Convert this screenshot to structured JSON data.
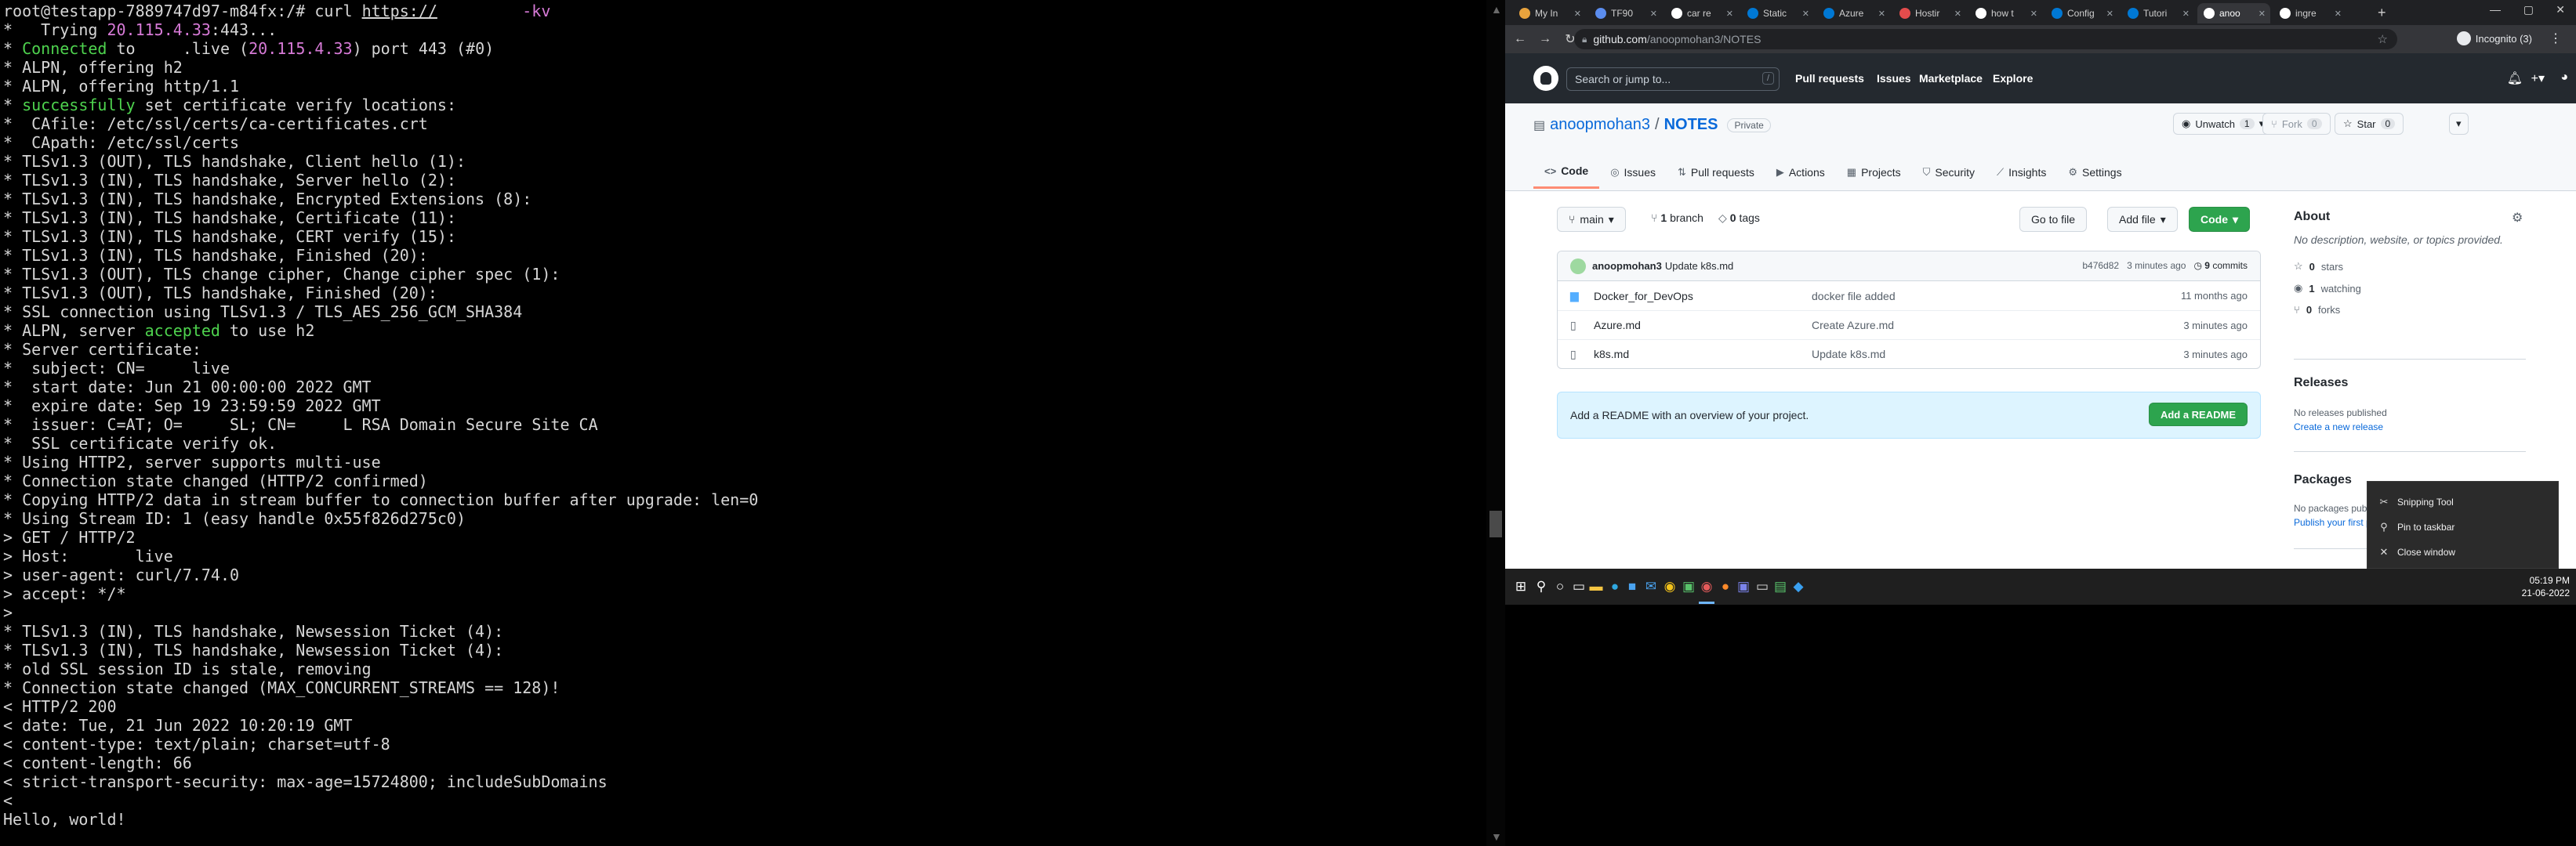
{
  "terminal": {
    "lines": [
      [
        {
          "t": "root@testapp-7889747d97-m84fx:/# curl "
        },
        {
          "t": "https://",
          "c": "u"
        },
        {
          "t": "       ",
          "c": "r"
        },
        {
          "t": "  -kv",
          "c": "p"
        }
      ],
      [
        {
          "t": "*   Trying "
        },
        {
          "t": "20.115.4.33",
          "c": "p"
        },
        {
          "t": ":443..."
        }
      ],
      [
        {
          "t": "* "
        },
        {
          "t": "Connected",
          "c": "g"
        },
        {
          "t": " to "
        },
        {
          "t": "    ",
          "c": "r"
        },
        {
          "t": ".live ("
        },
        {
          "t": "20.115.4.33",
          "c": "p"
        },
        {
          "t": ") port 443 (#0)"
        }
      ],
      [
        {
          "t": "* ALPN, offering h2"
        }
      ],
      [
        {
          "t": "* ALPN, offering http/1.1"
        }
      ],
      [
        {
          "t": "* "
        },
        {
          "t": "successfully",
          "c": "g"
        },
        {
          "t": " set certificate verify locations:"
        }
      ],
      [
        {
          "t": "*  CAfile: /etc/ssl/certs/ca-certificates.crt"
        }
      ],
      [
        {
          "t": "*  CApath: /etc/ssl/certs"
        }
      ],
      [
        {
          "t": "* TLSv1.3 (OUT), TLS handshake, Client hello (1):"
        }
      ],
      [
        {
          "t": "* TLSv1.3 (IN), TLS handshake, Server hello (2):"
        }
      ],
      [
        {
          "t": "* TLSv1.3 (IN), TLS handshake, Encrypted Extensions (8):"
        }
      ],
      [
        {
          "t": "* TLSv1.3 (IN), TLS handshake, Certificate (11):"
        }
      ],
      [
        {
          "t": "* TLSv1.3 (IN), TLS handshake, CERT verify (15):"
        }
      ],
      [
        {
          "t": "* TLSv1.3 (IN), TLS handshake, Finished (20):"
        }
      ],
      [
        {
          "t": "* TLSv1.3 (OUT), TLS change cipher, Change cipher spec (1):"
        }
      ],
      [
        {
          "t": "* TLSv1.3 (OUT), TLS handshake, Finished (20):"
        }
      ],
      [
        {
          "t": "* SSL connection using TLSv1.3 / TLS_AES_256_GCM_SHA384"
        }
      ],
      [
        {
          "t": "* ALPN, server "
        },
        {
          "t": "accepted",
          "c": "g"
        },
        {
          "t": " to use h2"
        }
      ],
      [
        {
          "t": "* Server certificate:"
        }
      ],
      [
        {
          "t": "*  subject: CN="
        },
        {
          "t": "     ",
          "c": "r"
        },
        {
          "t": "live"
        }
      ],
      [
        {
          "t": "*  start date: Jun 21 00:00:00 2022 GMT"
        }
      ],
      [
        {
          "t": "*  expire date: Sep 19 23:59:59 2022 GMT"
        }
      ],
      [
        {
          "t": "*  issuer: C=AT; O="
        },
        {
          "t": "     ",
          "c": "r"
        },
        {
          "t": "SL; CN="
        },
        {
          "t": "     ",
          "c": "r"
        },
        {
          "t": "L RSA Domain Secure Site CA"
        }
      ],
      [
        {
          "t": "*  SSL certificate verify ok."
        }
      ],
      [
        {
          "t": "* Using HTTP2, server supports multi-use"
        }
      ],
      [
        {
          "t": "* Connection state changed (HTTP/2 confirmed)"
        }
      ],
      [
        {
          "t": "* Copying HTTP/2 data in stream buffer to connection buffer after upgrade: len=0"
        }
      ],
      [
        {
          "t": "* Using Stream ID: 1 (easy handle 0x55f826d275c0)"
        }
      ],
      [
        {
          "t": "> GET / HTTP/2"
        }
      ],
      [
        {
          "t": "> Host: "
        },
        {
          "t": "      ",
          "c": "r"
        },
        {
          "t": "live"
        }
      ],
      [
        {
          "t": "> user-agent: curl/7.74.0"
        }
      ],
      [
        {
          "t": "> accept: */*"
        }
      ],
      [
        {
          "t": ">"
        }
      ],
      [
        {
          "t": "* TLSv1.3 (IN), TLS handshake, Newsession Ticket (4):"
        }
      ],
      [
        {
          "t": "* TLSv1.3 (IN), TLS handshake, Newsession Ticket (4):"
        }
      ],
      [
        {
          "t": "* old SSL session ID is stale, removing"
        }
      ],
      [
        {
          "t": "* Connection state changed (MAX_CONCURRENT_STREAMS == 128)!"
        }
      ],
      [
        {
          "t": "< HTTP/2 200"
        }
      ],
      [
        {
          "t": "< date: Tue, 21 Jun 2022 10:20:19 GMT"
        }
      ],
      [
        {
          "t": "< content-type: text/plain; charset=utf-8"
        }
      ],
      [
        {
          "t": "< content-length: 66"
        }
      ],
      [
        {
          "t": "< strict-transport-security: max-age=15724800; includeSubDomains"
        }
      ],
      [
        {
          "t": "<"
        }
      ],
      [
        {
          "t": "Hello, world!"
        }
      ]
    ],
    "scroll_up_icon": "triangle-up-icon",
    "scroll_down_icon": "triangle-down-icon"
  },
  "browser": {
    "tabs": [
      {
        "label": "My In",
        "fav": "#e8a33d"
      },
      {
        "label": "TF90",
        "fav": "#5b8def"
      },
      {
        "label": "car re",
        "fav": "#ffffff"
      },
      {
        "label": "Static",
        "fav": "#0078d4"
      },
      {
        "label": "Azure",
        "fav": "#0078d4"
      },
      {
        "label": "Hostir",
        "fav": "#e34c4c"
      },
      {
        "label": "how t",
        "fav": "#ffffff"
      },
      {
        "label": "Config",
        "fav": "#0078d4"
      },
      {
        "label": "Tutori",
        "fav": "#0078d4"
      },
      {
        "label": "anoo",
        "fav": "#ffffff",
        "active": true
      },
      {
        "label": "ingre",
        "fav": "#ffffff"
      }
    ],
    "url_host": "github.com",
    "url_path": "/anoopmohan3/NOTES",
    "incognito_label": "Incognito (3)"
  },
  "github": {
    "search_placeholder": "Search or jump to...",
    "search_key": "/",
    "nav": [
      "Pull requests",
      "Issues",
      "Marketplace",
      "Explore"
    ],
    "owner": "anoopmohan3",
    "sep": "/",
    "repo": "NOTES",
    "visibility": "Private",
    "unwatch": {
      "label": "Unwatch",
      "count": "1"
    },
    "fork": {
      "label": "Fork",
      "count": "0"
    },
    "star": {
      "label": "Star",
      "count": "0"
    },
    "tabs": [
      {
        "label": "Code",
        "icon": "<>"
      },
      {
        "label": "Issues",
        "icon": "◎"
      },
      {
        "label": "Pull requests",
        "icon": "⇅"
      },
      {
        "label": "Actions",
        "icon": "▶"
      },
      {
        "label": "Projects",
        "icon": "▦"
      },
      {
        "label": "Security",
        "icon": "⛉"
      },
      {
        "label": "Insights",
        "icon": "⟋"
      },
      {
        "label": "Settings",
        "icon": "⚙"
      }
    ],
    "branch_button": "main",
    "branch_count": "1",
    "branch_word": "branch",
    "tag_count": "0",
    "tag_word": "tags",
    "goto_file": "Go to file",
    "add_file": "Add file",
    "code_button": "Code",
    "commit": {
      "author": "anoopmohan3",
      "message": "Update k8s.md",
      "hash": "b476d82",
      "age": "3 minutes ago",
      "count": "9",
      "count_word": "commits"
    },
    "files": [
      {
        "name": "Docker_for_DevOps",
        "type": "dir",
        "message": "docker file added",
        "age": "11 months ago"
      },
      {
        "name": "Azure.md",
        "type": "file",
        "message": "Create Azure.md",
        "age": "3 minutes ago"
      },
      {
        "name": "k8s.md",
        "type": "file",
        "message": "Update k8s.md",
        "age": "3 minutes ago"
      }
    ],
    "readme_prompt": "Add a README with an overview of your project.",
    "readme_button": "Add a README",
    "about": {
      "title": "About",
      "description": "No description, website, or topics provided.",
      "stars_count": "0",
      "stars_word": "stars",
      "watching_count": "1",
      "watching_word": "watching",
      "forks_count": "0",
      "forks_word": "forks"
    },
    "releases": {
      "title": "Releases",
      "none": "No releases published",
      "link": "Create a new release"
    },
    "packages": {
      "title": "Packages",
      "none": "No packages published",
      "link": "Publish your first package"
    }
  },
  "context_menu": [
    {
      "label": "Snipping Tool",
      "icon": "snipping-tool-icon"
    },
    {
      "label": "Pin to taskbar",
      "icon": "pin-icon"
    },
    {
      "label": "Close window",
      "icon": "close-icon"
    }
  ],
  "taskbar": {
    "time": "05:19 PM",
    "date": "21-06-2022",
    "icons": [
      {
        "name": "start-icon",
        "glyph": "⊞",
        "color": "#ffffff"
      },
      {
        "name": "search-icon",
        "glyph": "⚲",
        "color": "#ffffff"
      },
      {
        "name": "cortana-icon",
        "glyph": "○",
        "color": "#ffffff"
      },
      {
        "name": "task-view-icon",
        "glyph": "▭",
        "color": "#ffffff"
      },
      {
        "name": "file-explorer-icon",
        "glyph": "▬",
        "color": "#f5c542"
      },
      {
        "name": "edge-icon",
        "glyph": "●",
        "color": "#2fa8e0"
      },
      {
        "name": "store-icon",
        "glyph": "■",
        "color": "#4aa3f0"
      },
      {
        "name": "mail-icon",
        "glyph": "✉",
        "color": "#4aa3f0"
      },
      {
        "name": "chrome-icon",
        "glyph": "◉",
        "color": "#f2c21b"
      },
      {
        "name": "app-icon",
        "glyph": "▣",
        "color": "#58c26a"
      },
      {
        "name": "chrome-incognito-icon",
        "glyph": "◉",
        "color": "#e55a5a",
        "active": true
      },
      {
        "name": "firefox-icon",
        "glyph": "●",
        "color": "#ff8a2a"
      },
      {
        "name": "teams-icon",
        "glyph": "▣",
        "color": "#7b83eb"
      },
      {
        "name": "terminal-icon",
        "glyph": "▭",
        "color": "#dddddd"
      },
      {
        "name": "notepad-icon",
        "glyph": "▤",
        "color": "#58c26a"
      },
      {
        "name": "vscode-icon",
        "glyph": "◆",
        "color": "#3aa0f0"
      }
    ]
  }
}
